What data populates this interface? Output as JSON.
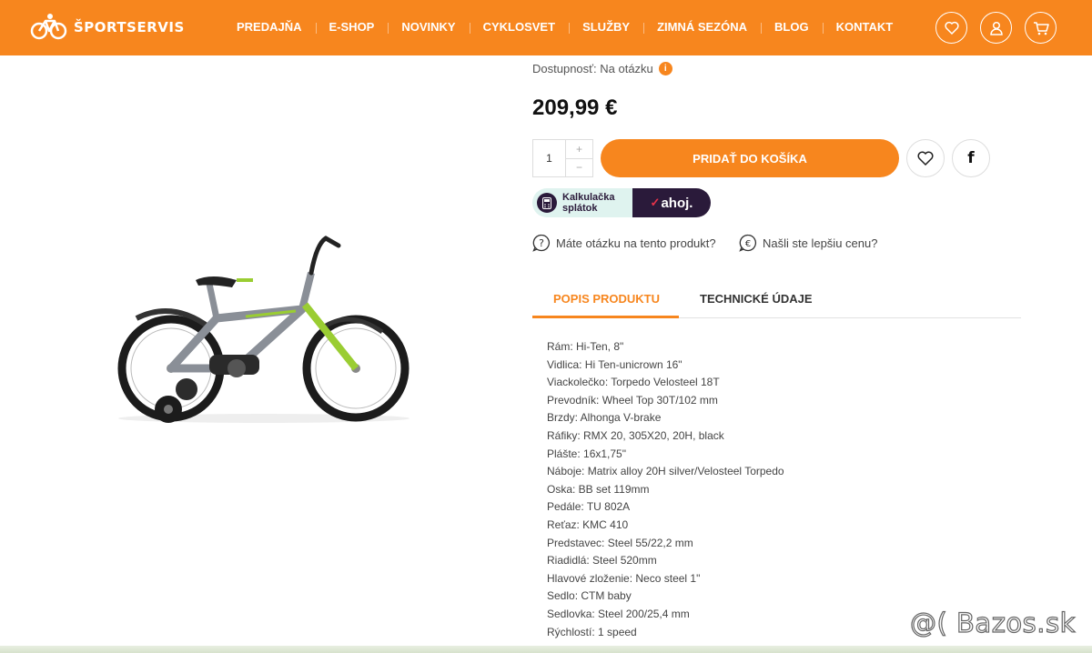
{
  "header": {
    "logo_text": "ŠPORTSERVIS",
    "nav": [
      "PREDAJŇA",
      "E-SHOP",
      "NOVINKY",
      "CYKLOSVET",
      "SLUŽBY",
      "ZIMNÁ SEZÓNA",
      "BLOG",
      "KONTAKT"
    ],
    "icons": [
      "heart-icon",
      "user-icon",
      "cart-icon"
    ]
  },
  "product": {
    "availability": "Dostupnosť: Na otázku",
    "info_icon": "i",
    "price": "209,99 €",
    "quantity": "1",
    "qty_plus": "+",
    "qty_minus": "−",
    "add_to_cart": "PRIDAŤ DO KOŠÍKA",
    "facebook_glyph": "f"
  },
  "calculator": {
    "label_line1": "Kalkulačka",
    "label_line2": "splátok",
    "brand": "ahoj."
  },
  "links": {
    "question": "Máte otázku na tento produkt?",
    "better_price": "Našli ste lepšiu cenu?"
  },
  "tabs": [
    "POPIS PRODUKTU",
    "TECHNICKÉ ÚDAJE"
  ],
  "specs": [
    "Rám: Hi-Ten, 8\"",
    "Vidlica: Hi Ten-unicrown 16\"",
    "Viackolečko: Torpedo Velosteel 18T",
    "Prevodník: Wheel Top 30T/102 mm",
    "Brzdy: Alhonga V-brake",
    "Ráfiky: RMX 20, 305X20, 20H, black",
    "Plášte: 16x1,75\"",
    "Náboje: Matrix alloy 20H silver/Velosteel Torpedo",
    "Oska: BB set 119mm",
    "Pedále: TU 802A",
    "Reťaz: KMC 410",
    "Predstavec: Steel 55/22,2 mm",
    "Riadidlá: Steel 520mm",
    "Hlavové zloženie: Neco steel 1\"",
    "Sedlo: CTM baby",
    "Sedlovka: Steel 200/25,4 mm",
    "Rýchlostí: 1 speed"
  ],
  "watermark": "@( Bazos.sk",
  "colors": {
    "accent": "#f7861e",
    "ahoj_dark": "#2a1a3a",
    "ahoj_red": "#e8334a"
  }
}
